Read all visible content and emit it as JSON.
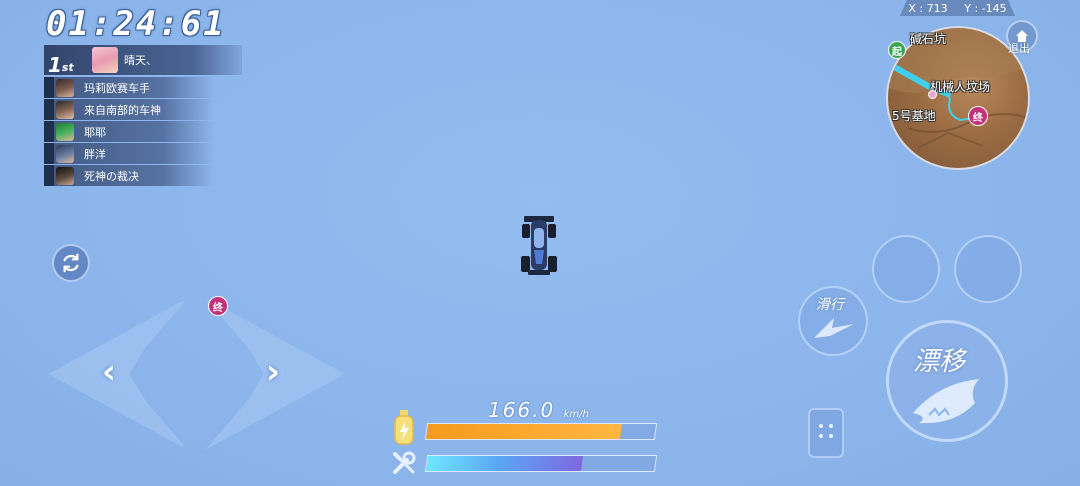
{
  "hud": {
    "timer": "01:24:61",
    "coords": {
      "x": "X : 713",
      "y": "Y : -145"
    },
    "exit_label": "退出"
  },
  "ranking": {
    "first_place": {
      "rank": "1",
      "suffix": "st",
      "name": "晴天、"
    },
    "others": [
      {
        "name": "玛莉欧赛车手"
      },
      {
        "name": "来自南部的车神"
      },
      {
        "name": "耶耶"
      },
      {
        "name": "胖洋"
      },
      {
        "name": "死神の裁决"
      }
    ]
  },
  "minimap": {
    "start_badge": "起",
    "end_badge": "终",
    "labels": [
      "碱石坑",
      "机械人坟场",
      "5号基地"
    ]
  },
  "track_marker": {
    "end_badge": "终"
  },
  "speed": {
    "value": "166.0",
    "unit": "km/h"
  },
  "bars": {
    "nitro_fill": 0.85,
    "durability_fill": 0.68,
    "nitro_color": "#f59a1c",
    "durability_color": "#7f68e0"
  },
  "controls": {
    "glide_label": "滑行",
    "drift_label": "漂移"
  }
}
